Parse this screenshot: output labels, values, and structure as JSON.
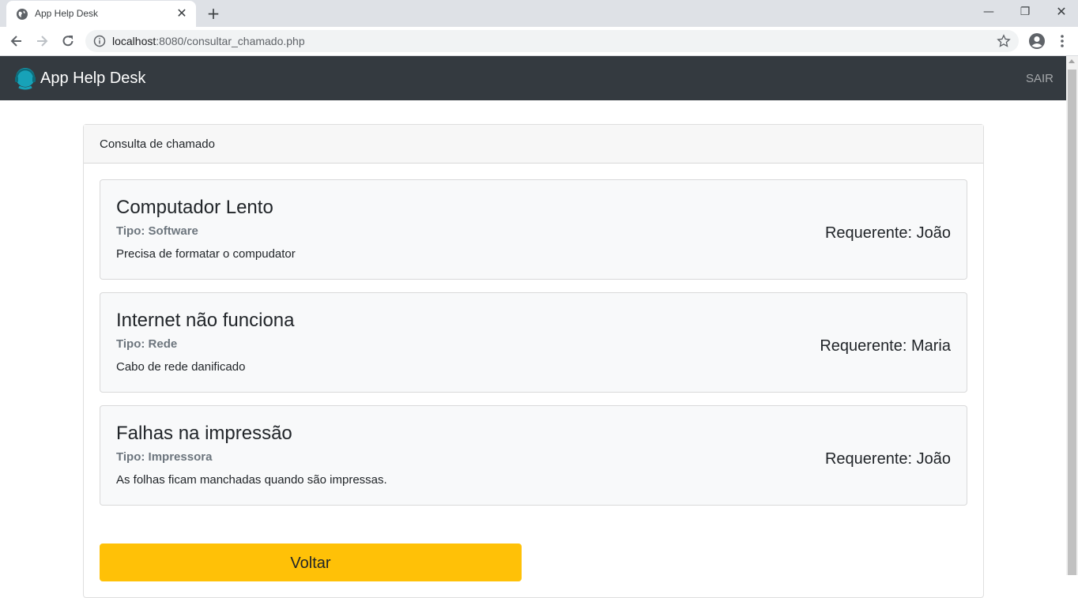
{
  "browser": {
    "tab_title": "App Help Desk",
    "url_host": "localhost",
    "url_rest": ":8080/consultar_chamado.php"
  },
  "navbar": {
    "brand": "App Help Desk",
    "logout_label": "SAIR"
  },
  "card": {
    "header": "Consulta de chamado",
    "tickets": [
      {
        "title": "Computador Lento",
        "type": "Tipo: Software",
        "description": "Precisa de formatar o compudator",
        "requester": "Requerente: João"
      },
      {
        "title": "Internet não funciona",
        "type": "Tipo: Rede",
        "description": "Cabo de rede danificado",
        "requester": "Requerente: Maria"
      },
      {
        "title": "Falhas na impressão",
        "type": "Tipo: Impressora",
        "description": "As folhas ficam manchadas quando são impressas.",
        "requester": "Requerente: João"
      }
    ],
    "back_label": "Voltar"
  },
  "colors": {
    "navbar_bg": "#343a40",
    "button_bg": "#ffc107",
    "brand_icon": "#17a2b8"
  }
}
